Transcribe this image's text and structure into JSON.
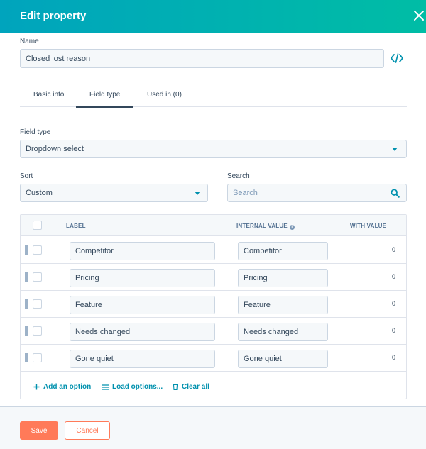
{
  "header": {
    "title": "Edit property",
    "close_icon": "close-icon"
  },
  "name": {
    "label": "Name",
    "value": "Closed lost reason",
    "code_icon": "code-icon"
  },
  "tabs": [
    {
      "label": "Basic info",
      "active": false
    },
    {
      "label": "Field type",
      "active": true
    },
    {
      "label": "Used in (0)",
      "active": false
    }
  ],
  "field_type": {
    "label": "Field type",
    "value": "Dropdown select"
  },
  "sort": {
    "label": "Sort",
    "value": "Custom"
  },
  "search": {
    "label": "Search",
    "placeholder": "Search"
  },
  "table": {
    "headers": {
      "label": "LABEL",
      "internal_value": "INTERNAL VALUE",
      "with_value": "WITH VALUE"
    },
    "rows": [
      {
        "label": "Competitor",
        "internal_value": "Competitor",
        "count": "0"
      },
      {
        "label": "Pricing",
        "internal_value": "Pricing",
        "count": "0"
      },
      {
        "label": "Feature",
        "internal_value": "Feature",
        "count": "0"
      },
      {
        "label": "Needs changed",
        "internal_value": "Needs changed",
        "count": "0"
      },
      {
        "label": "Gone quiet",
        "internal_value": "Gone quiet",
        "count": "0"
      }
    ],
    "actions": {
      "add": "Add an option",
      "load": "Load options...",
      "clear": "Clear all"
    }
  },
  "buttons": {
    "save": "Save",
    "cancel": "Cancel"
  },
  "colors": {
    "header_start": "#00a4bd",
    "header_end": "#00bda5",
    "accent": "#0091ae",
    "primary_button": "#ff7a59"
  }
}
